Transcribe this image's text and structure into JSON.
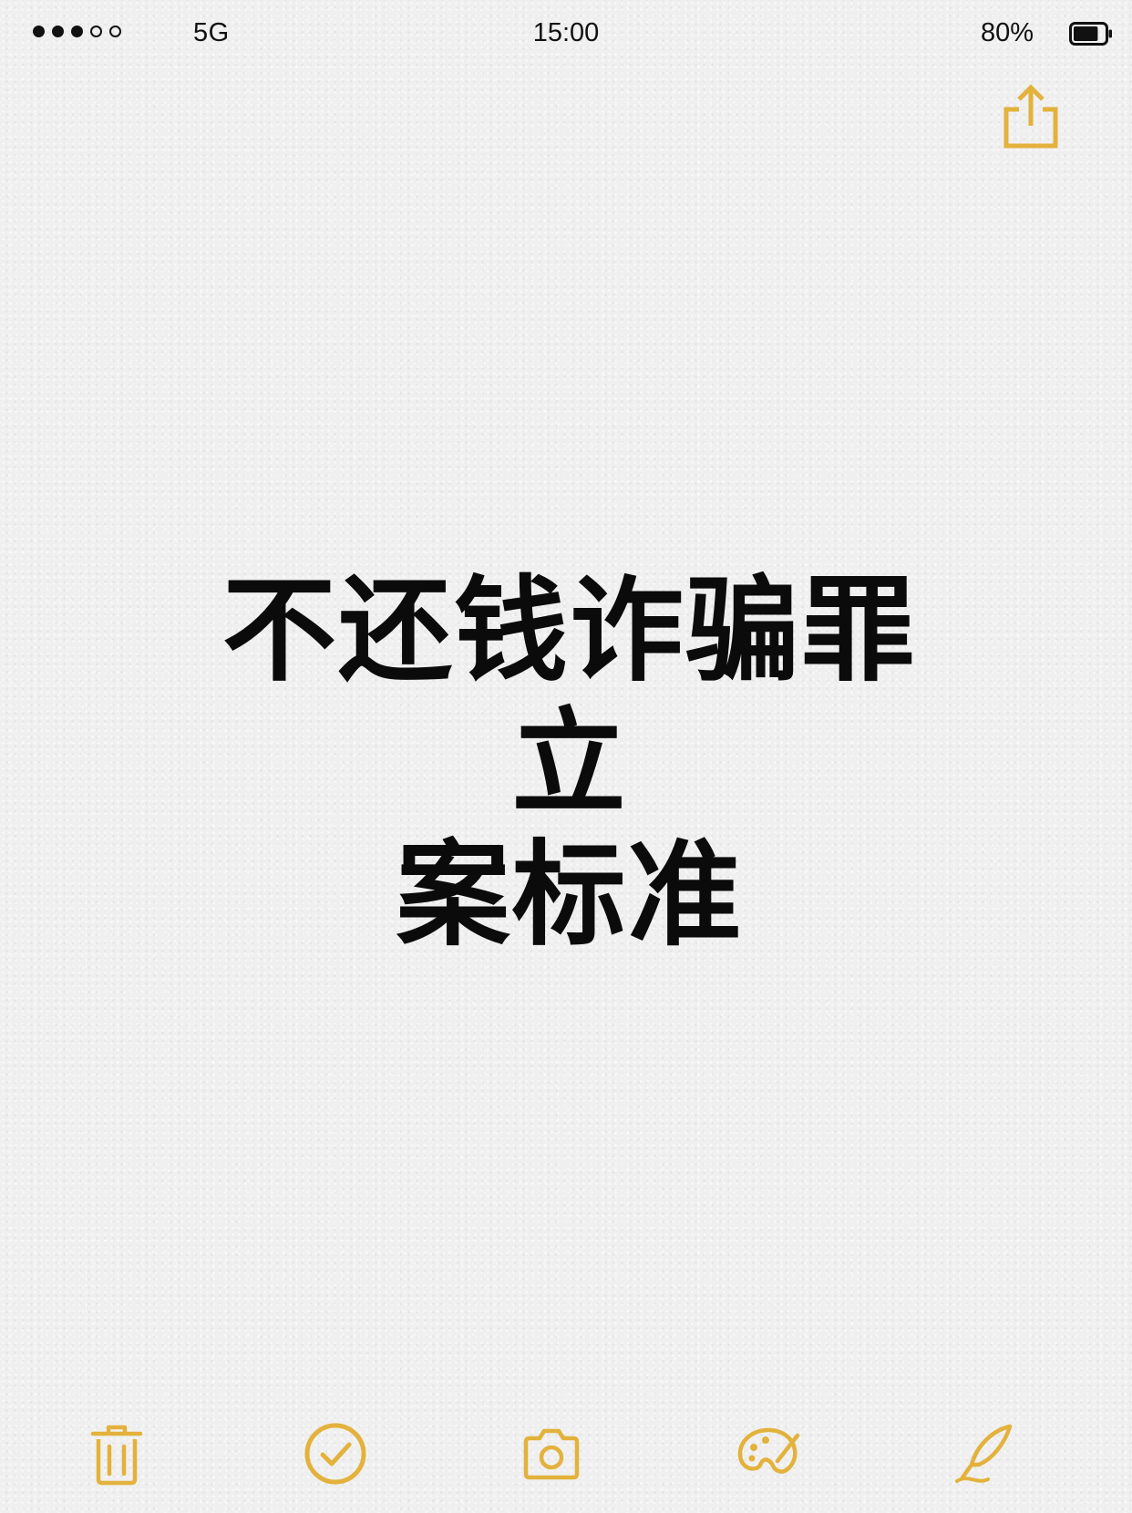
{
  "status_bar": {
    "signal_bars": 5,
    "signal_filled": 3,
    "network": "5G",
    "time": "15:00",
    "battery_percent": "80%",
    "battery_level": 0.8
  },
  "toolbar_top": {
    "share_icon": "share-icon"
  },
  "note": {
    "title_lines": [
      "不还钱诈骗罪立",
      "案标准"
    ]
  },
  "toolbar_bottom": {
    "items": [
      "trash-icon",
      "checklist-icon",
      "camera-icon",
      "markup-icon",
      "compose-icon"
    ]
  },
  "colors": {
    "accent": "#e3b23c",
    "text": "#111111",
    "background": "#efefef"
  }
}
